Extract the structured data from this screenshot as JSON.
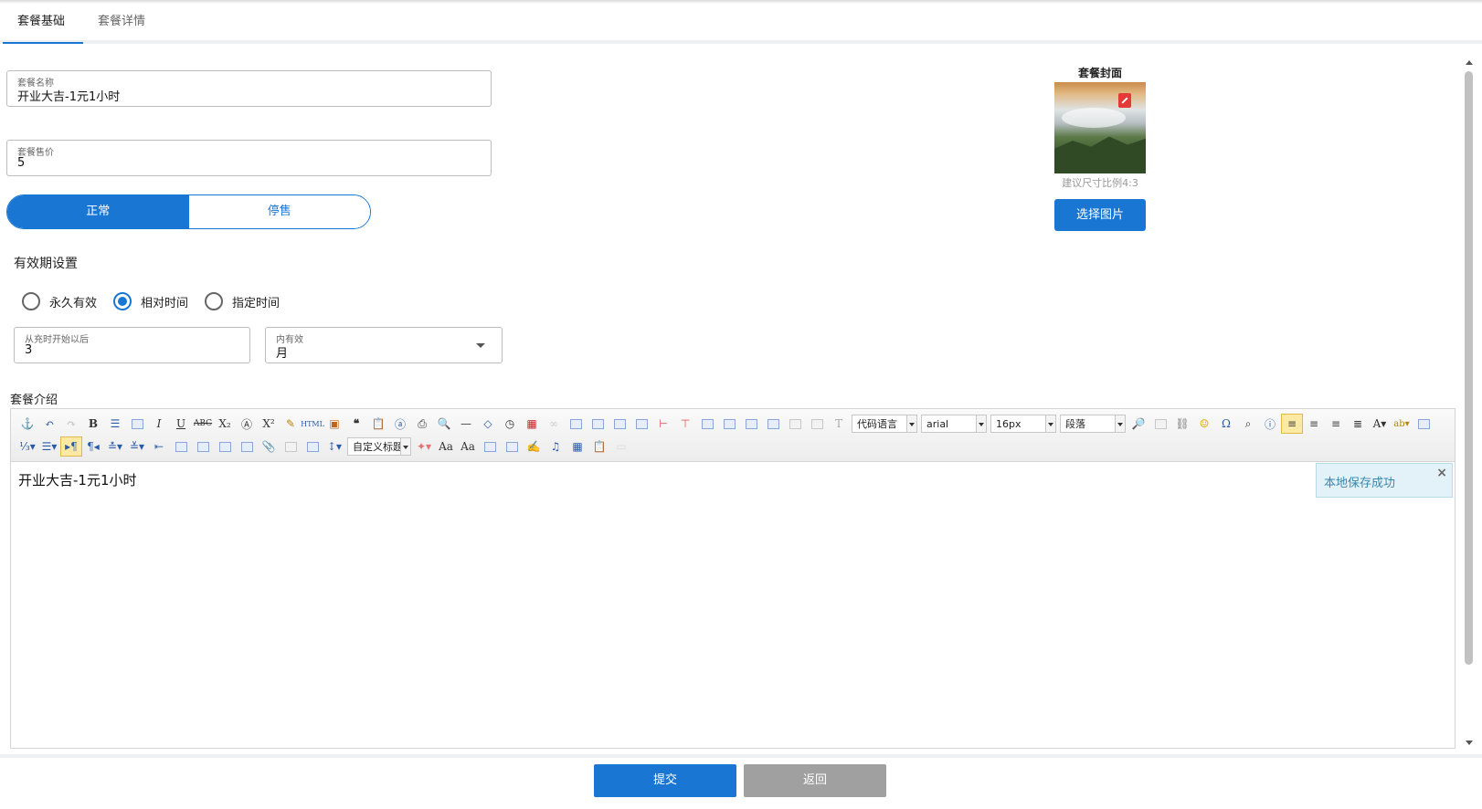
{
  "tabs": [
    "套餐基础",
    "套餐详情"
  ],
  "form": {
    "name_label": "套餐名称",
    "name_value": "开业大吉-1元1小时",
    "price_label": "套餐售价",
    "price_value": "5",
    "status_on": "正常",
    "status_off": "停售"
  },
  "validity": {
    "title": "有效期设置",
    "options": [
      "永久有效",
      "相对时间",
      "指定时间"
    ],
    "selected": "相对时间",
    "from_label": "从充时开始以后",
    "from_value": "3",
    "unit_label": "内有效",
    "unit_value": "月"
  },
  "cover": {
    "title": "套餐封面",
    "hint": "建议尺寸比例4:3",
    "button": "选择图片"
  },
  "intro": {
    "title": "套餐介绍",
    "content": "开业大吉-1元1小时",
    "toolbar": {
      "code_language": "代码语言",
      "font_family": "arial",
      "font_size": "16px",
      "paragraph": "段落",
      "custom_heading": "自定义标题"
    },
    "toast": "本地保存成功"
  },
  "actions": {
    "submit": "提交",
    "back": "返回"
  },
  "colors": {
    "primary": "#1976d2",
    "disabled": "#a0a0a0"
  }
}
